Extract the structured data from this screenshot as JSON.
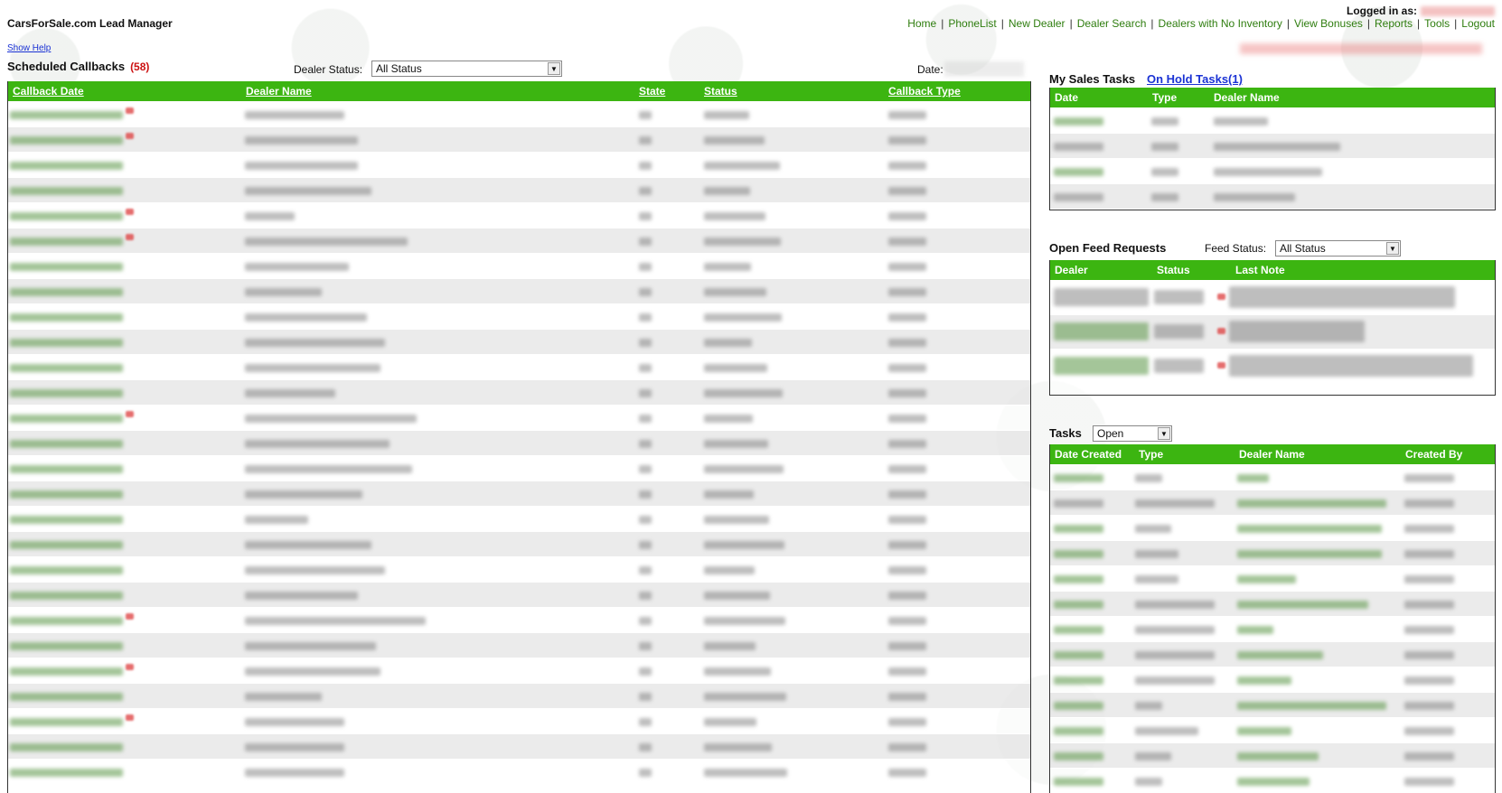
{
  "header": {
    "brand": "CarsForSale.com Lead Manager",
    "logged_in_label": "Logged in as:",
    "nav": [
      "Home",
      "PhoneList",
      "New Dealer",
      "Dealer Search",
      "Dealers with No Inventory",
      "View Bonuses",
      "Reports",
      "Tools",
      "Logout"
    ]
  },
  "help": {
    "show_help": "Show Help"
  },
  "callbacks": {
    "title": "Scheduled Callbacks",
    "count": "(58)",
    "dealer_status_label": "Dealer Status:",
    "dealer_status_value": "All Status",
    "date_label": "Date:",
    "columns": [
      "Callback Date",
      "Dealer Name",
      "State",
      "Status",
      "Callback Type"
    ]
  },
  "sales_tasks": {
    "title": "My Sales Tasks",
    "on_hold_link": "On Hold Tasks(1)",
    "columns": [
      "Date",
      "Type",
      "Dealer Name"
    ]
  },
  "feed_requests": {
    "title": "Open Feed Requests",
    "feed_status_label": "Feed Status:",
    "feed_status_value": "All Status",
    "columns": [
      "Dealer",
      "Status",
      "Last Note"
    ]
  },
  "tasks": {
    "title": "Tasks",
    "filter_value": "Open",
    "columns": [
      "Date Created",
      "Type",
      "Dealer Name",
      "Created By"
    ]
  },
  "colors": {
    "header_green": "#3cb511",
    "link_green": "#2e7d0e",
    "link_blue": "#1a32d4",
    "count_red": "#cc1111"
  }
}
